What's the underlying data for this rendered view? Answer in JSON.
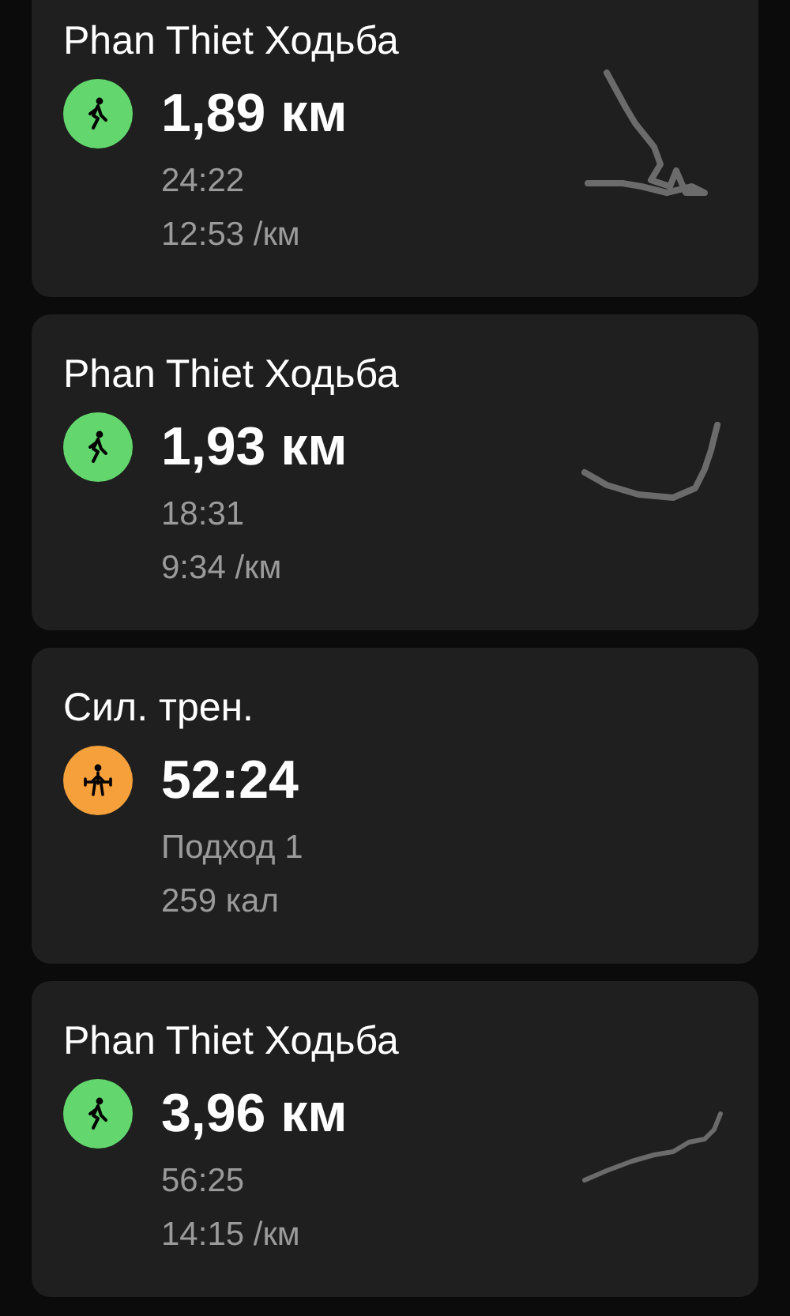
{
  "workouts": [
    {
      "kind": "walk",
      "title": "Phan Thiet Ходьба",
      "value": "1,89 км",
      "details": [
        "24:22",
        "12:53 /км"
      ]
    },
    {
      "kind": "walk",
      "title": "Phan Thiet Ходьба",
      "value": "1,93 км",
      "details": [
        "18:31",
        "9:34 /км"
      ]
    },
    {
      "kind": "strength",
      "title": "Сил. трен.",
      "value": "52:24",
      "details": [
        "Подход 1",
        "259 кал"
      ]
    },
    {
      "kind": "walk",
      "title": "Phan Thiet Ходьба",
      "value": "3,96 км",
      "details": [
        "56:25",
        "14:15 /км"
      ]
    }
  ]
}
